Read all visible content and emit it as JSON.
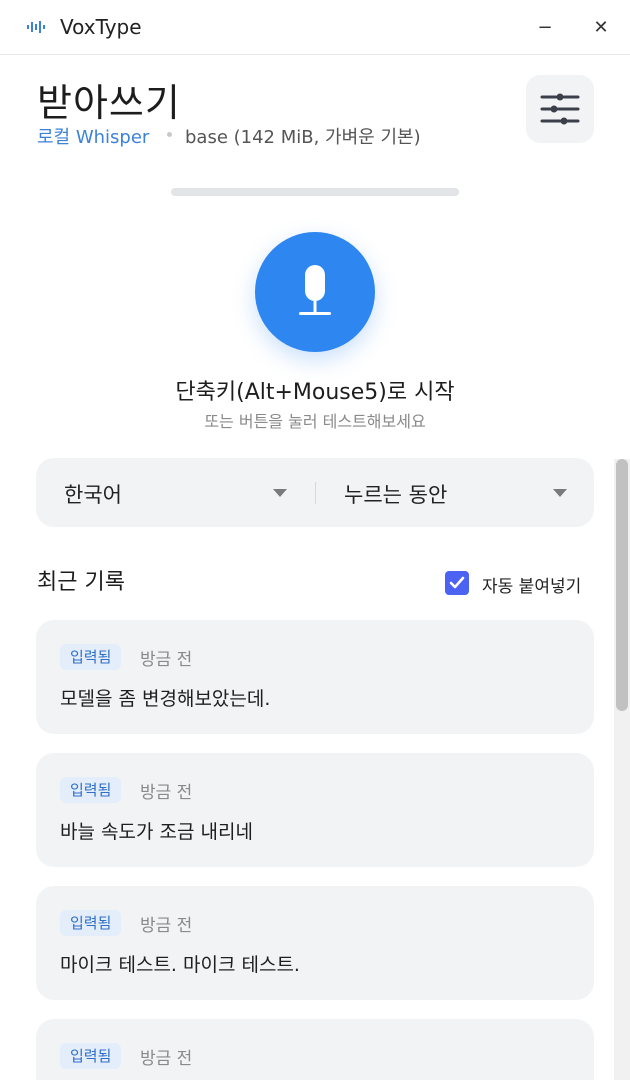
{
  "window": {
    "title": "VoxType",
    "minimize_glyph": "−",
    "close_glyph": "✕",
    "app_icon": "waveform-icon"
  },
  "header": {
    "title": "받아쓰기",
    "engine": "로컬 Whisper",
    "model": "base (142 MiB, 가벼운 기본)",
    "settings_icon": "sliders-icon"
  },
  "recorder": {
    "mic_icon": "microphone-icon",
    "hint_main": "단축키(Alt+Mouse5)로 시작",
    "hint_sub": "또는 버튼을 눌러 테스트해보세요",
    "level": 0
  },
  "selectors": {
    "language": "한국어",
    "mode": "누르는 동안"
  },
  "history": {
    "title": "최근 기록",
    "auto_paste_label": "자동 붙여넣기",
    "auto_paste_checked": true,
    "items": [
      {
        "badge": "입력됨",
        "time": "방금 전",
        "text": "모델을 좀 변경해보았는데."
      },
      {
        "badge": "입력됨",
        "time": "방금 전",
        "text": "바늘 속도가 조금 내리네"
      },
      {
        "badge": "입력됨",
        "time": "방금 전",
        "text": "마이크 테스트. 마이크 테스트."
      },
      {
        "badge": "입력됨",
        "time": "방금 전",
        "text": ""
      }
    ]
  },
  "colors": {
    "accent": "#2e86f0",
    "engine_link": "#3b82d9",
    "checkbox": "#4b62f2",
    "badge_bg": "#e4eefb",
    "badge_text": "#2f6fc9"
  }
}
